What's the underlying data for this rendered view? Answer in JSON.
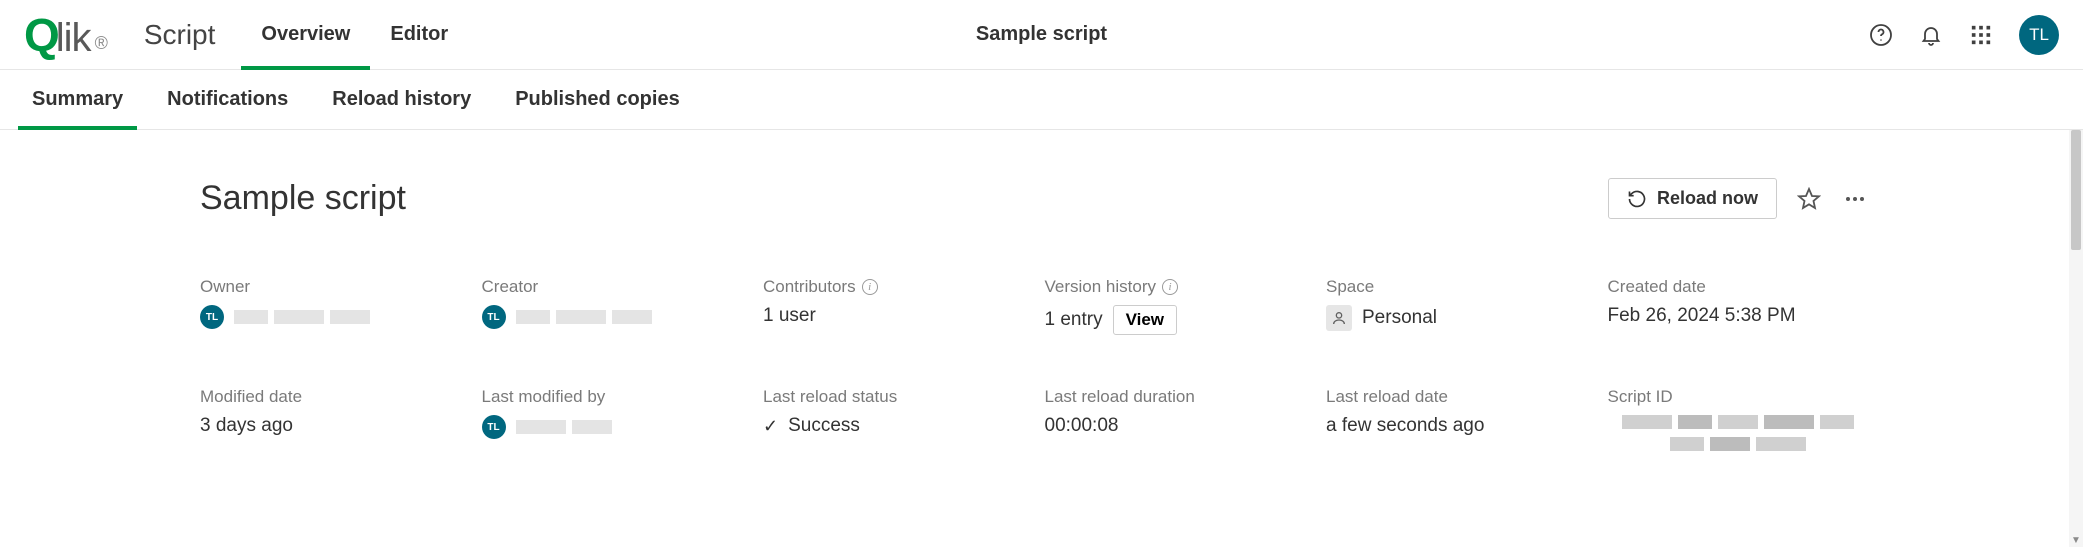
{
  "header": {
    "app_context": "Script",
    "tabs": [
      {
        "label": "Overview",
        "active": true
      },
      {
        "label": "Editor",
        "active": false
      }
    ],
    "title": "Sample script",
    "user_initials": "TL"
  },
  "sub_tabs": [
    {
      "label": "Summary",
      "active": true
    },
    {
      "label": "Notifications",
      "active": false
    },
    {
      "label": "Reload history",
      "active": false
    },
    {
      "label": "Published copies",
      "active": false
    }
  ],
  "page": {
    "title": "Sample script",
    "reload_button": "Reload now"
  },
  "meta": {
    "owner": {
      "label": "Owner",
      "initials": "TL"
    },
    "creator": {
      "label": "Creator",
      "initials": "TL"
    },
    "contributors": {
      "label": "Contributors",
      "value": "1 user"
    },
    "version_history": {
      "label": "Version history",
      "value": "1 entry",
      "view_label": "View"
    },
    "space": {
      "label": "Space",
      "value": "Personal"
    },
    "created_date": {
      "label": "Created date",
      "value": "Feb 26, 2024 5:38 PM"
    },
    "modified_date": {
      "label": "Modified date",
      "value": "3 days ago"
    },
    "last_modified_by": {
      "label": "Last modified by",
      "initials": "TL"
    },
    "last_reload_status": {
      "label": "Last reload status",
      "value": "Success"
    },
    "last_reload_duration": {
      "label": "Last reload duration",
      "value": "00:00:08"
    },
    "last_reload_date": {
      "label": "Last reload date",
      "value": "a few seconds ago"
    },
    "script_id": {
      "label": "Script ID"
    }
  }
}
